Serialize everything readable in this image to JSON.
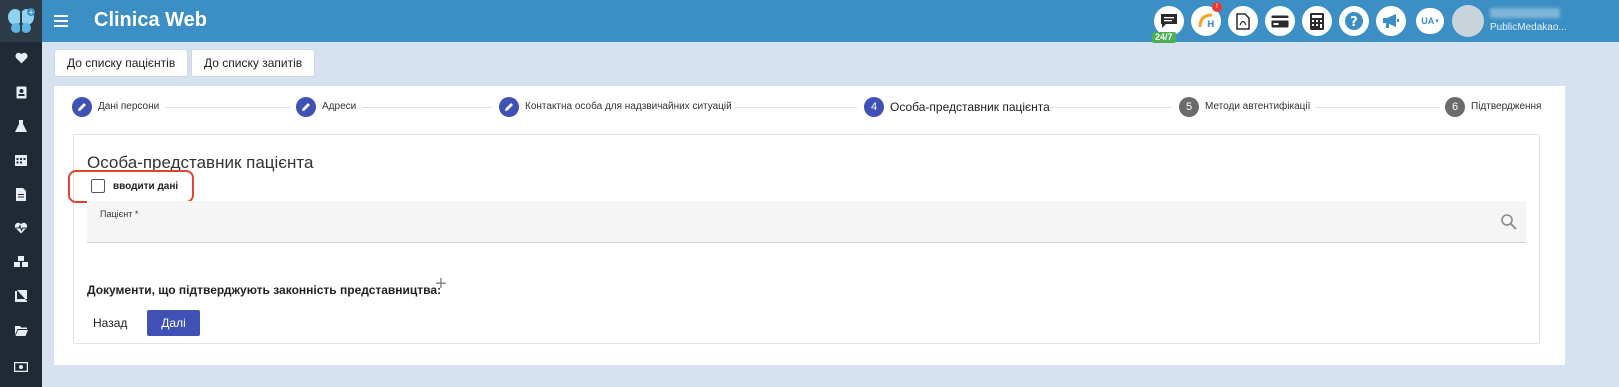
{
  "app": {
    "title": "Clinica Web"
  },
  "topbar": {
    "support_badge": "24/7",
    "alert_badge": "!",
    "language": "UA",
    "user_org": "PublicMedakao..."
  },
  "sidebar": {
    "icons": [
      "heart-icon",
      "id-card-icon",
      "flask-icon",
      "calendar-icon",
      "document-icon",
      "heartbeat-icon",
      "cubes-icon",
      "book-icon",
      "folder-icon",
      "money-icon"
    ]
  },
  "nav": {
    "patients_list": "До списку пацієнтів",
    "requests_list": "До списку запитів"
  },
  "stepper": {
    "steps": [
      {
        "label": "Дані персони",
        "marker": "",
        "state": "done"
      },
      {
        "label": "Адреси",
        "marker": "",
        "state": "done"
      },
      {
        "label": "Контактна особа для надзвичайних ситуацій",
        "marker": "",
        "state": "done"
      },
      {
        "label": "Особа-представник пацієнта",
        "marker": "4",
        "state": "active"
      },
      {
        "label": "Методи автентифікації",
        "marker": "5",
        "state": "pending"
      },
      {
        "label": "Підтвердження",
        "marker": "6",
        "state": "pending"
      }
    ]
  },
  "form": {
    "section_title": "Особа-представник пацієнта",
    "enter_data_label": "вводити дані",
    "enter_data_checked": false,
    "patient_label": "Пацієнт *",
    "patient_value": "",
    "documents_label": "Документи, що підтверджують законність представництва:",
    "add_label": "+",
    "back_label": "Назад",
    "next_label": "Далі"
  },
  "colors": {
    "topbar": "#3b8fc4",
    "sidebar": "#1f2a35",
    "primary": "#3f51b5",
    "highlight": "#e0452f"
  }
}
